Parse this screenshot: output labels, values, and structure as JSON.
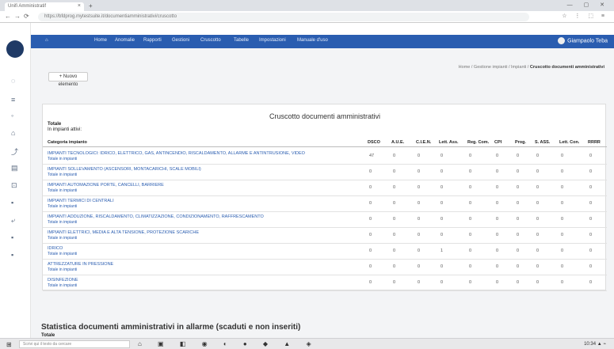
{
  "browser": {
    "tab_title": "Unifi Amministratif",
    "tab_close": "×",
    "new_tab": "+",
    "window_controls": "— ▢ ✕",
    "nav": {
      "back": "←",
      "forward": "→",
      "reload": "⟳"
    },
    "url": "https://bfdprog.mytestsuite.it/documentiamministrativi/cruscotto",
    "extensions": "☆ ⋮ ⬚ ≡"
  },
  "leftbar": {
    "icons": [
      "◌",
      "≡",
      "◦",
      "⌂",
      "⤴",
      "▤",
      "⊡",
      "▪",
      "⤶",
      "▪",
      "▪"
    ]
  },
  "topnav": {
    "brand": "⌂",
    "items": [
      "Home",
      "Anomalie",
      "Rapporti",
      "Gestioni",
      "Cruscotto",
      "Tabelle",
      "Impostazioni",
      "Manuale d'uso"
    ],
    "user": "Giampaolo Teba"
  },
  "page": {
    "new_button": "+ Nuovo elemento",
    "breadcrumb": "Home / Gestione impianti / Impianti /",
    "breadcrumb_current": "Cruscotto documenti amministrativi"
  },
  "panel": {
    "title": "Cruscotto documenti amministrativi",
    "sub1": "Totale",
    "sub2": "In impianti attivi:",
    "headers": [
      "Categoria impianto",
      "DSCO",
      "A.U.E.",
      "C.I.E.N.",
      "Lett. Ass.",
      "Reg. Com.",
      "CPI",
      "Prog.",
      "S. ASS.",
      "Lett. Con.",
      "RRRR"
    ],
    "rows": [
      {
        "cat": "IMPIANTI TECNOLOGICI: IDRICO, ELETTRICO, GAS, ANTINCENDIO, RISCALDAMENTO, ALLARME E ANTINTRUSIONE, VIDEO",
        "sub": "Totale in impianti",
        "vals": [
          "47",
          "0",
          "0",
          "0",
          "0",
          "0",
          "0",
          "0",
          "0",
          "0"
        ]
      },
      {
        "cat": "IMPIANTI SOLLEVAMENTO (ASCENSORI, MONTACARICHI, SCALE MOBILI)",
        "sub": "Totale in impianti",
        "vals": [
          "0",
          "0",
          "0",
          "0",
          "0",
          "0",
          "0",
          "0",
          "0",
          "0"
        ]
      },
      {
        "cat": "IMPIANTI AUTOMAZIONE PORTE, CANCELLI, BARRIERE",
        "sub": "Totale in impianti",
        "vals": [
          "0",
          "0",
          "0",
          "0",
          "0",
          "0",
          "0",
          "0",
          "0",
          "0"
        ]
      },
      {
        "cat": "IMPIANTI TERMICI DI CENTRALI",
        "sub": "Totale in impianti",
        "vals": [
          "0",
          "0",
          "0",
          "0",
          "0",
          "0",
          "0",
          "0",
          "0",
          "0"
        ]
      },
      {
        "cat": "IMPIANTI ADDUZIONE, RISCALDAMENTO, CLIMATIZZAZIONE, CONDIZIONAMENTO, RAFFRESCAMENTO",
        "sub": "Totale in impianti",
        "vals": [
          "0",
          "0",
          "0",
          "0",
          "0",
          "0",
          "0",
          "0",
          "0",
          "0"
        ]
      },
      {
        "cat": "IMPIANTI ELETTRICI, MEDIA E ALTA TENSIONE, PROTEZIONE SCARICHE",
        "sub": "Totale in impianti",
        "vals": [
          "0",
          "0",
          "0",
          "0",
          "0",
          "0",
          "0",
          "0",
          "0",
          "0"
        ]
      },
      {
        "cat": "IDRICO",
        "sub": "Totale in impianti",
        "vals": [
          "0",
          "0",
          "0",
          "1",
          "0",
          "0",
          "0",
          "0",
          "0",
          "0"
        ]
      },
      {
        "cat": "ATTREZZATURE IN PRESSIONE",
        "sub": "Totale in impianti",
        "vals": [
          "0",
          "0",
          "0",
          "0",
          "0",
          "0",
          "0",
          "0",
          "0",
          "0"
        ]
      },
      {
        "cat": "DISINFEZIONE",
        "sub": "Totale in impianti",
        "vals": [
          "0",
          "0",
          "0",
          "0",
          "0",
          "0",
          "0",
          "0",
          "0",
          "0"
        ]
      }
    ]
  },
  "stats": {
    "title": "Statistica documenti amministrativi in allarme (scaduti e non inseriti)",
    "sub": "Totale"
  },
  "taskbar": {
    "start": "⊞",
    "search": "Scrivi qui il testo da cercare",
    "apps": "⌂ ▣ ◧ ◉ ◐ ● ◆ ▲ ◈",
    "clock": "10:34 ▲ ⌁"
  }
}
